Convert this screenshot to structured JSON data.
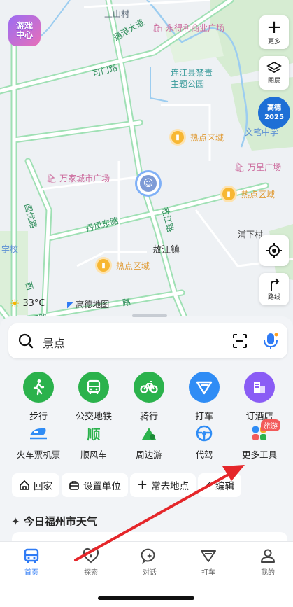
{
  "map": {
    "labels": {
      "shangshancun": "上山村",
      "tongjiang": "通港大道",
      "kemen": "可门路",
      "guoyou": "国优路",
      "danfeng_east": "丹凤东路",
      "aojiang_road": "敖江路",
      "aojiang_town": "敖江镇",
      "puxiacun": "浦下村",
      "xi": "西",
      "school": "学校",
      "xichang": "西路",
      "donglu": "路"
    },
    "pois": {
      "yongdeli": "永得利商业广场",
      "forbidden_park": "连江县禁毒\n主题公园",
      "wanjia": "万家城市广场",
      "wanxing": "万星广场",
      "wenbi": "文笔中学"
    },
    "hot_label": "热点区域",
    "game_center": "游戏\n中心",
    "gaode_badge": "高德\n2025",
    "temperature": "33°C",
    "map_brand": "高德地图",
    "buttons": {
      "more": "更多",
      "layers": "图层",
      "route": "路线"
    }
  },
  "search": {
    "placeholder": "景点"
  },
  "services": [
    {
      "label": "步行",
      "color": "#2bb24c"
    },
    {
      "label": "公交地铁",
      "color": "#2bb24c"
    },
    {
      "label": "骑行",
      "color": "#2bb24c"
    },
    {
      "label": "打车",
      "color": "#2f8cf5"
    },
    {
      "label": "订酒店",
      "color": "#8a5cf5"
    }
  ],
  "tools": [
    {
      "label": "火车票机票"
    },
    {
      "label": "顺风车"
    },
    {
      "label": "周边游"
    },
    {
      "label": "代驾"
    },
    {
      "label": "更多工具",
      "badge": "旅游"
    }
  ],
  "tool_glyphs": {
    "shunfeng": "顺"
  },
  "shortcuts": {
    "home": "回家",
    "work": "设置单位",
    "frequent": "常去地点",
    "edit": "编辑"
  },
  "weather": {
    "title": "今日福州市天气"
  },
  "nav": [
    {
      "label": "首页",
      "active": true
    },
    {
      "label": "探索",
      "active": false
    },
    {
      "label": "对话",
      "active": false
    },
    {
      "label": "打车",
      "active": false
    },
    {
      "label": "我的",
      "active": false
    }
  ],
  "colors": {
    "accent": "#2f7bf5",
    "annotation_arrow": "#e5262a"
  }
}
